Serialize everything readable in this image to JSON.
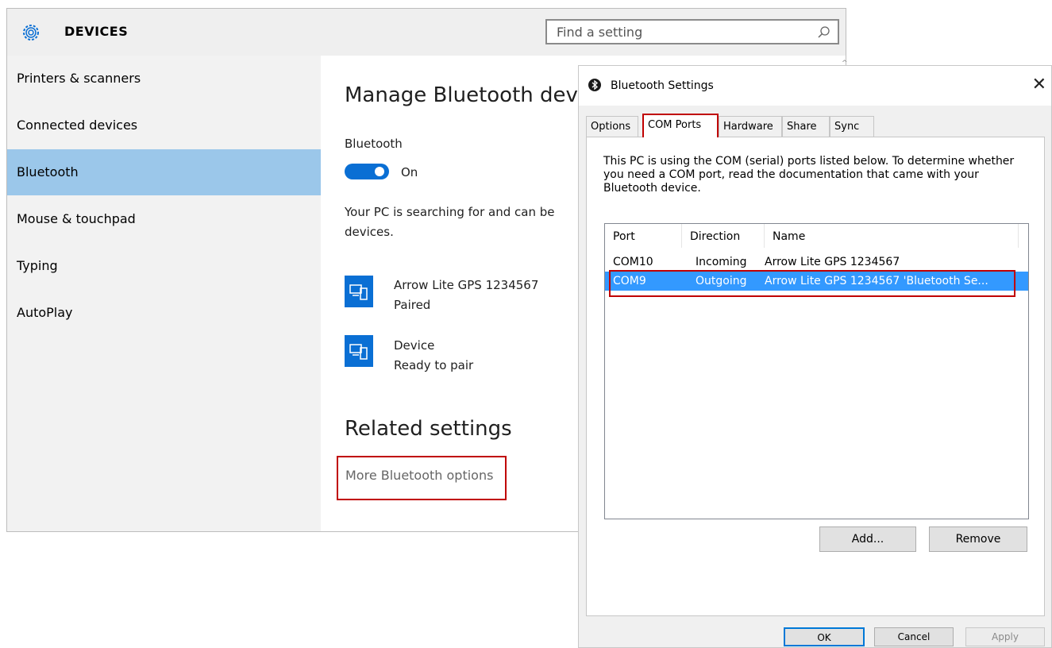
{
  "settings": {
    "header_title": "DEVICES",
    "search_placeholder": "Find a setting",
    "sidebar": [
      {
        "label": "Printers & scanners",
        "selected": false
      },
      {
        "label": "Connected devices",
        "selected": false
      },
      {
        "label": "Bluetooth",
        "selected": true
      },
      {
        "label": "Mouse & touchpad",
        "selected": false
      },
      {
        "label": "Typing",
        "selected": false
      },
      {
        "label": "AutoPlay",
        "selected": false
      }
    ],
    "main": {
      "title": "Manage Bluetooth devi",
      "bluetooth_label": "Bluetooth",
      "toggle_state": "On",
      "searching_line1": "Your PC is searching for and can be",
      "searching_line2": "devices.",
      "devices": [
        {
          "name": "Arrow Lite GPS 1234567",
          "status": "Paired"
        },
        {
          "name": "Device",
          "status": "Ready to pair"
        }
      ],
      "related_title": "Related settings",
      "more_link": "More Bluetooth options"
    }
  },
  "dialog": {
    "title": "Bluetooth Settings",
    "tabs": [
      "Options",
      "COM Ports",
      "Hardware",
      "Share",
      "Sync"
    ],
    "active_tab": "COM Ports",
    "description": "This PC is using the COM (serial) ports listed below. To determine whether you need a COM port, read the documentation that came with your Bluetooth device.",
    "columns": [
      "Port",
      "Direction",
      "Name"
    ],
    "rows": [
      {
        "port": "COM10",
        "direction": "Incoming",
        "name": "Arrow Lite GPS 1234567"
      },
      {
        "port": "COM9",
        "direction": "Outgoing",
        "name": "Arrow Lite GPS 1234567 'Bluetooth Se..."
      }
    ],
    "selected_row": "COM9",
    "buttons": {
      "add": "Add...",
      "remove": "Remove",
      "ok": "OK",
      "cancel": "Cancel",
      "apply": "Apply"
    }
  },
  "colors": {
    "accent": "#0a6fd4",
    "selection": "#9bc7ea",
    "highlight_outline": "#c00000",
    "row_selected": "#3399ff"
  },
  "icons": [
    "gear-icon",
    "search-icon",
    "bluetooth-icon",
    "device-icon",
    "close-icon"
  ]
}
